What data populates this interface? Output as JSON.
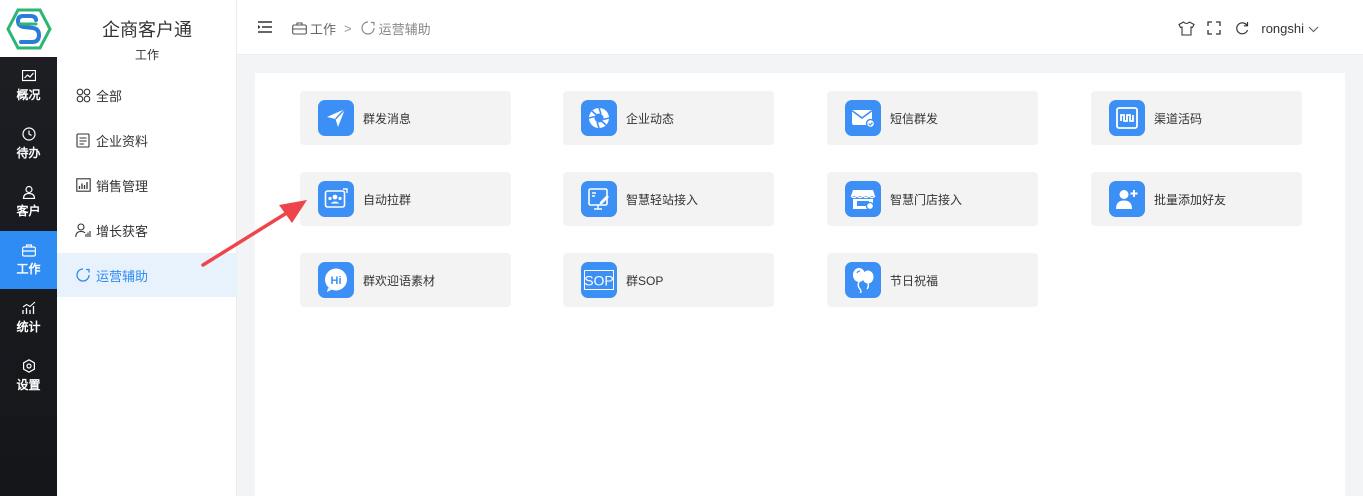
{
  "app": {
    "title": "企商客户通",
    "subtitle": "工作"
  },
  "rail": {
    "items": [
      {
        "label": "概况",
        "icon": "chart-icon",
        "active": false
      },
      {
        "label": "待办",
        "icon": "clock-icon",
        "active": false
      },
      {
        "label": "客户",
        "icon": "user-icon",
        "active": false
      },
      {
        "label": "工作",
        "icon": "briefcase-icon",
        "active": true
      },
      {
        "label": "统计",
        "icon": "stats-icon",
        "active": false
      },
      {
        "label": "设置",
        "icon": "gear-icon",
        "active": false
      }
    ]
  },
  "sidebar": {
    "items": [
      {
        "label": "全部",
        "icon": "grid-icon",
        "active": false
      },
      {
        "label": "企业资料",
        "icon": "document-icon",
        "active": false
      },
      {
        "label": "销售管理",
        "icon": "sales-chart-icon",
        "active": false
      },
      {
        "label": "增长获客",
        "icon": "user-growth-icon",
        "active": false
      },
      {
        "label": "运营辅助",
        "icon": "ops-icon",
        "active": true
      }
    ]
  },
  "topbar": {
    "breadcrumb": [
      "工作",
      "运营辅助"
    ],
    "breadcrumb_sep": ">",
    "username": "rongshi"
  },
  "cards": [
    {
      "label": "群发消息",
      "icon": "send-icon"
    },
    {
      "label": "企业动态",
      "icon": "aperture-icon"
    },
    {
      "label": "短信群发",
      "icon": "mail-icon"
    },
    {
      "label": "渠道活码",
      "icon": "qrcode-icon"
    },
    {
      "label": "自动拉群",
      "icon": "group-pull-icon"
    },
    {
      "label": "智慧轻站接入",
      "icon": "microsite-icon"
    },
    {
      "label": "智慧门店接入",
      "icon": "store-icon"
    },
    {
      "label": "批量添加好友",
      "icon": "add-friend-icon"
    },
    {
      "label": "群欢迎语素材",
      "icon": "hi-icon"
    },
    {
      "label": "群SOP",
      "icon": "sop-icon"
    },
    {
      "label": "节日祝福",
      "icon": "balloon-icon"
    }
  ],
  "colors": {
    "accent": "#2f8cf2",
    "tile": "#3c8ff5",
    "arrow": "#f0444b",
    "rail": "#1d1f24"
  }
}
